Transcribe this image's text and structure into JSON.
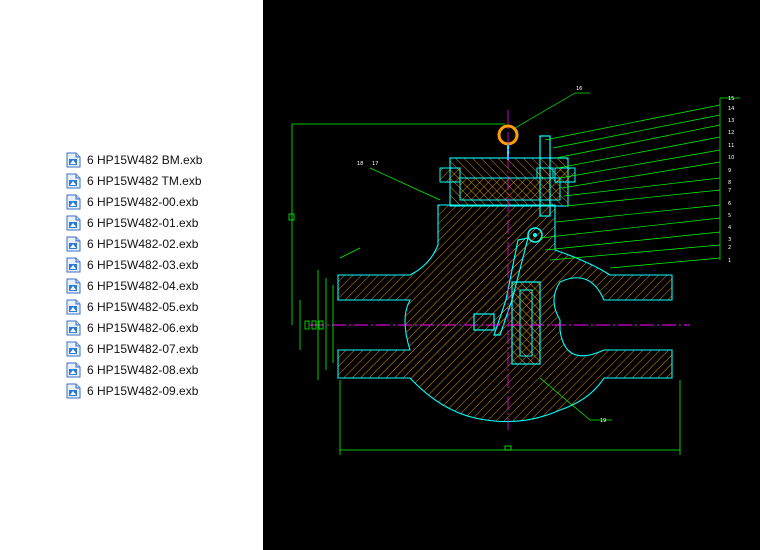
{
  "files": [
    {
      "name": "6 HP15W482 BM.exb"
    },
    {
      "name": "6 HP15W482 TM.exb"
    },
    {
      "name": "6 HP15W482-00.exb"
    },
    {
      "name": "6 HP15W482-01.exb"
    },
    {
      "name": "6 HP15W482-02.exb"
    },
    {
      "name": "6 HP15W482-03.exb"
    },
    {
      "name": "6 HP15W482-04.exb"
    },
    {
      "name": "6 HP15W482-05.exb"
    },
    {
      "name": "6 HP15W482-06.exb"
    },
    {
      "name": "6 HP15W482-07.exb"
    },
    {
      "name": "6 HP15W482-08.exb"
    },
    {
      "name": "6 HP15W482-09.exb"
    }
  ],
  "drawing": {
    "balloons": [
      "15",
      "14",
      "13",
      "12",
      "11",
      "10",
      "9",
      "8",
      "7",
      "6",
      "5",
      "4",
      "3",
      "2",
      "1",
      "16",
      "18",
      "17",
      "19"
    ],
    "colors": {
      "background": "#000000",
      "outline": "#00ffff",
      "dimension": "#00ff00",
      "centerline": "#ff00ff",
      "hatch": "#ffa000",
      "leader": "#00ff00",
      "text": "#ffffff"
    }
  }
}
